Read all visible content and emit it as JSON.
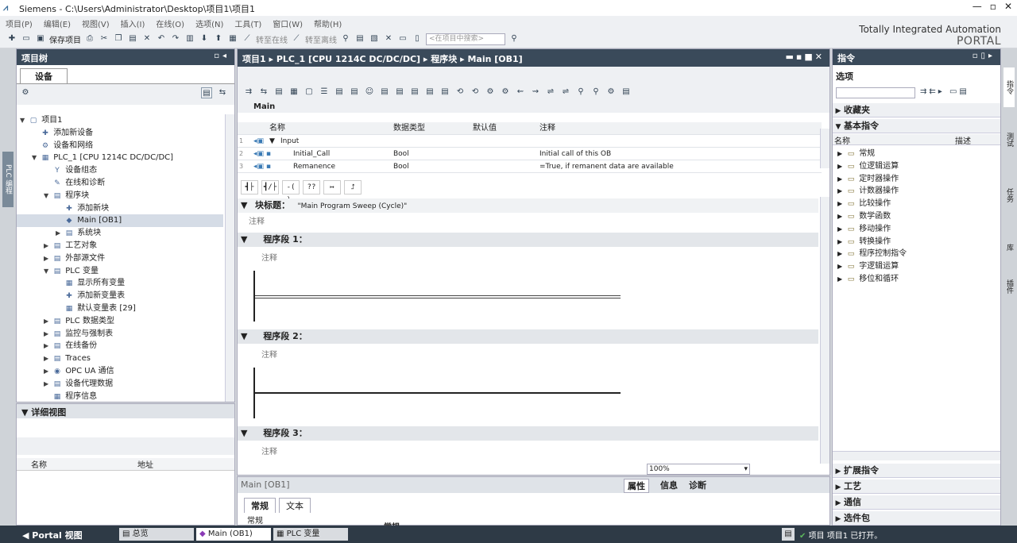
{
  "window": {
    "app": "Siemens",
    "path": "C:\\Users\\Administrator\\Desktop\\项目1\\项目1"
  },
  "menu": [
    "项目(P)",
    "编辑(E)",
    "视图(V)",
    "插入(I)",
    "在线(O)",
    "选项(N)",
    "工具(T)",
    "窗口(W)",
    "帮助(H)"
  ],
  "toolbar": {
    "save_label": "保存项目",
    "go_online": "转至在线",
    "go_offline": "转至离线",
    "search_placeholder": "<在项目中搜索>"
  },
  "brand": {
    "line1": "Totally Integrated Automation",
    "line2": "PORTAL"
  },
  "left_strip": "PLC 编程",
  "project_tree": {
    "title": "项目树",
    "tab": "设备",
    "items": [
      {
        "label": "项目1",
        "level": 0,
        "exp": "▼",
        "icon": "▢"
      },
      {
        "label": "添加新设备",
        "level": 1,
        "exp": "",
        "icon": "✚"
      },
      {
        "label": "设备和网络",
        "level": 1,
        "exp": "",
        "icon": "⚙"
      },
      {
        "label": "PLC_1 [CPU 1214C DC/DC/DC]",
        "level": 1,
        "exp": "▼",
        "icon": "▦"
      },
      {
        "label": "设备组态",
        "level": 2,
        "exp": "",
        "icon": "Y"
      },
      {
        "label": "在线和诊断",
        "level": 2,
        "exp": "",
        "icon": "✎"
      },
      {
        "label": "程序块",
        "level": 2,
        "exp": "▼",
        "icon": "▤"
      },
      {
        "label": "添加新块",
        "level": 3,
        "exp": "",
        "icon": "✚"
      },
      {
        "label": "Main [OB1]",
        "level": 3,
        "exp": "",
        "icon": "◆",
        "sel": true
      },
      {
        "label": "系统块",
        "level": 3,
        "exp": "▶",
        "icon": "▤"
      },
      {
        "label": "工艺对象",
        "level": 2,
        "exp": "▶",
        "icon": "▤"
      },
      {
        "label": "外部源文件",
        "level": 2,
        "exp": "▶",
        "icon": "▤"
      },
      {
        "label": "PLC 变量",
        "level": 2,
        "exp": "▼",
        "icon": "▤"
      },
      {
        "label": "显示所有变量",
        "level": 3,
        "exp": "",
        "icon": "▦"
      },
      {
        "label": "添加新变量表",
        "level": 3,
        "exp": "",
        "icon": "✚"
      },
      {
        "label": "默认变量表 [29]",
        "level": 3,
        "exp": "",
        "icon": "▦"
      },
      {
        "label": "PLC 数据类型",
        "level": 2,
        "exp": "▶",
        "icon": "▤"
      },
      {
        "label": "监控与强制表",
        "level": 2,
        "exp": "▶",
        "icon": "▤"
      },
      {
        "label": "在线备份",
        "level": 2,
        "exp": "▶",
        "icon": "▤"
      },
      {
        "label": "Traces",
        "level": 2,
        "exp": "▶",
        "icon": "▤"
      },
      {
        "label": "OPC UA 通信",
        "level": 2,
        "exp": "▶",
        "icon": "◉"
      },
      {
        "label": "设备代理数据",
        "level": 2,
        "exp": "▶",
        "icon": "▤"
      },
      {
        "label": "程序信息",
        "level": 2,
        "exp": "",
        "icon": "▦"
      }
    ]
  },
  "detail_view": {
    "title": "详细视图",
    "col_name": "名称",
    "col_addr": "地址"
  },
  "editor": {
    "crumbs": [
      "项目1",
      "PLC_1 [CPU 1214C DC/DC/DC]",
      "程序块",
      "Main [OB1]"
    ],
    "interface_title": "Main",
    "cols": {
      "name": "名称",
      "type": "数据类型",
      "default": "默认值",
      "comment": "注释"
    },
    "rows": [
      {
        "num": "1",
        "name": "Input",
        "type": "",
        "comment": ""
      },
      {
        "num": "2",
        "name": "Initial_Call",
        "type": "Bool",
        "comment": "Initial call of this OB"
      },
      {
        "num": "3",
        "name": "Remanence",
        "type": "Bool",
        "comment": "=True, if remanent data are available"
      }
    ],
    "ladder_buttons": [
      "┫├",
      "┫/├",
      "-( )-",
      "??",
      "↦",
      "⮥"
    ],
    "block_title_label": "块标题：",
    "block_title": "\"Main Program Sweep (Cycle)\"",
    "comment": "注释",
    "networks": [
      {
        "label": "程序段 1："
      },
      {
        "label": "程序段 2："
      },
      {
        "label": "程序段 3："
      }
    ],
    "zoom": "100%"
  },
  "inspector": {
    "title": "Main [OB1]",
    "tab_props": "属性",
    "tab_info": "信息",
    "tab_diag": "诊断",
    "sub_general": "常规",
    "sub_text": "文本",
    "row_general": "常规",
    "row_general2": "常规"
  },
  "instructions": {
    "title": "指令",
    "options": "选项",
    "favorites": "收藏夹",
    "basic": "基本指令",
    "col_name": "名称",
    "col_desc": "描述",
    "items": [
      "常规",
      "位逻辑运算",
      "定时器操作",
      "计数器操作",
      "比较操作",
      "数学函数",
      "移动操作",
      "转换操作",
      "程序控制指令",
      "字逻辑运算",
      "移位和循环"
    ],
    "extended": "扩展指令",
    "tech": "工艺",
    "comm": "通信",
    "optional": "选件包"
  },
  "right_strip": [
    "指令",
    "测试",
    "任务",
    "库",
    "插件"
  ],
  "statusbar": {
    "portal": "Portal 视图",
    "tab_overview": "总览",
    "tab_main": "Main (OB1)",
    "tab_plc": "PLC 变量",
    "status": "项目 项目1 已打开。"
  }
}
